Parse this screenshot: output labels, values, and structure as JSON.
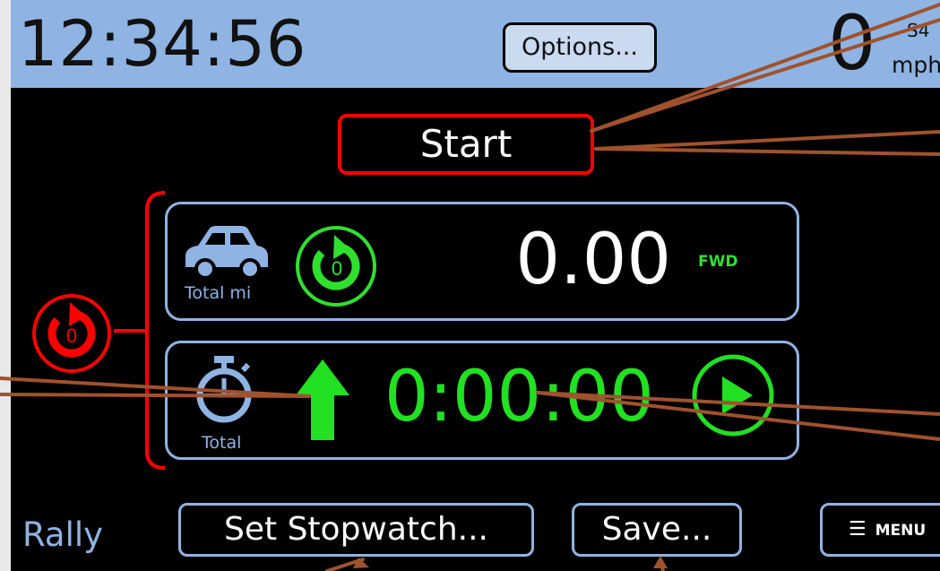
{
  "header": {
    "clock": "12:34:56",
    "options_label": "Options...",
    "speed_value": "0",
    "speed_top_text": "S4",
    "speed_unit": "mph"
  },
  "start_button": {
    "label": "Start"
  },
  "reset_all_icon": {
    "label": "0",
    "color": "#ff0000"
  },
  "distance_panel": {
    "icon": "car-icon",
    "icon_label": "Total mi",
    "reset_icon": {
      "label": "0",
      "color": "#2fe02f"
    },
    "value": "0.00",
    "direction": "FWD"
  },
  "time_panel": {
    "icon": "stopwatch-icon",
    "icon_label": "Total",
    "direction_icon": "up-arrow-icon",
    "value": "0:00:00",
    "play_icon": "play-icon"
  },
  "footer": {
    "mode": "Rally",
    "set_stopwatch_label": "Set Stopwatch...",
    "save_label": "Save...",
    "menu_label": "MENU"
  },
  "colors": {
    "topbar": "#8fb4e3",
    "accent_green": "#22e022",
    "alert_red": "#ff0000",
    "panel_border": "#8fb4e3",
    "callout": "#a0522d"
  }
}
